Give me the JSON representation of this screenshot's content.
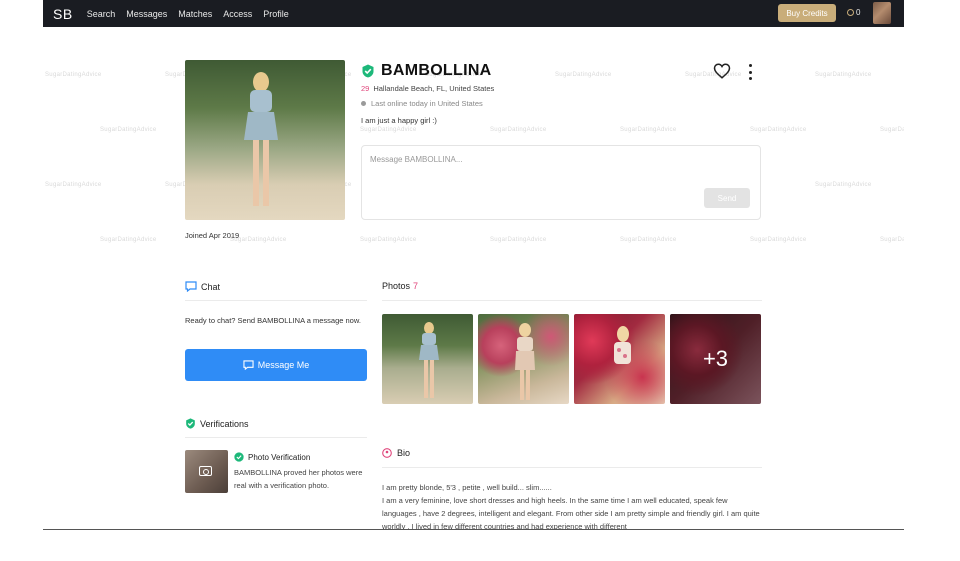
{
  "topbar": {
    "logo": "SB",
    "nav": [
      "Search",
      "Messages",
      "Matches",
      "Access",
      "Profile"
    ],
    "buy_credits": "Buy Credits",
    "credits_count": "0"
  },
  "watermark": "SugarDatingAdvice",
  "profile": {
    "name": "BAMBOLLINA",
    "age": "29",
    "location": "Hallandale Beach, FL, United States",
    "last_online": "Last online today in United States",
    "tagline": "I am just a happy girl :)",
    "joined": "Joined Apr 2019"
  },
  "message_box": {
    "placeholder": "Message BAMBOLLINA...",
    "send_label": "Send"
  },
  "chat": {
    "title": "Chat",
    "description": "Ready to chat? Send BAMBOLLINA a message now.",
    "button_label": "Message Me"
  },
  "verifications": {
    "title": "Verifications",
    "item_title": "Photo Verification",
    "item_description": "BAMBOLLINA proved her photos were real with a verification photo."
  },
  "photos": {
    "title": "Photos",
    "count": "7",
    "more_label": "+3"
  },
  "bio": {
    "title": "Bio",
    "lines": [
      "I am pretty blonde, 5'3 , petite , well build... slim......",
      "I am a very feminine, love short dresses and high heels. In the same time I am well educated, speak few languages , have 2 degrees, intelligent and elegant. From other side I am pretty simple and friendly girl. I am quite worldly . I lived in few different countries and had experience with different"
    ]
  },
  "colors": {
    "topbar_bg": "#1a1c22",
    "accent_gold": "#c9ad7a",
    "primary_blue": "#2f8cf6",
    "verified_green": "#1db87a",
    "pink": "#e0457b"
  }
}
